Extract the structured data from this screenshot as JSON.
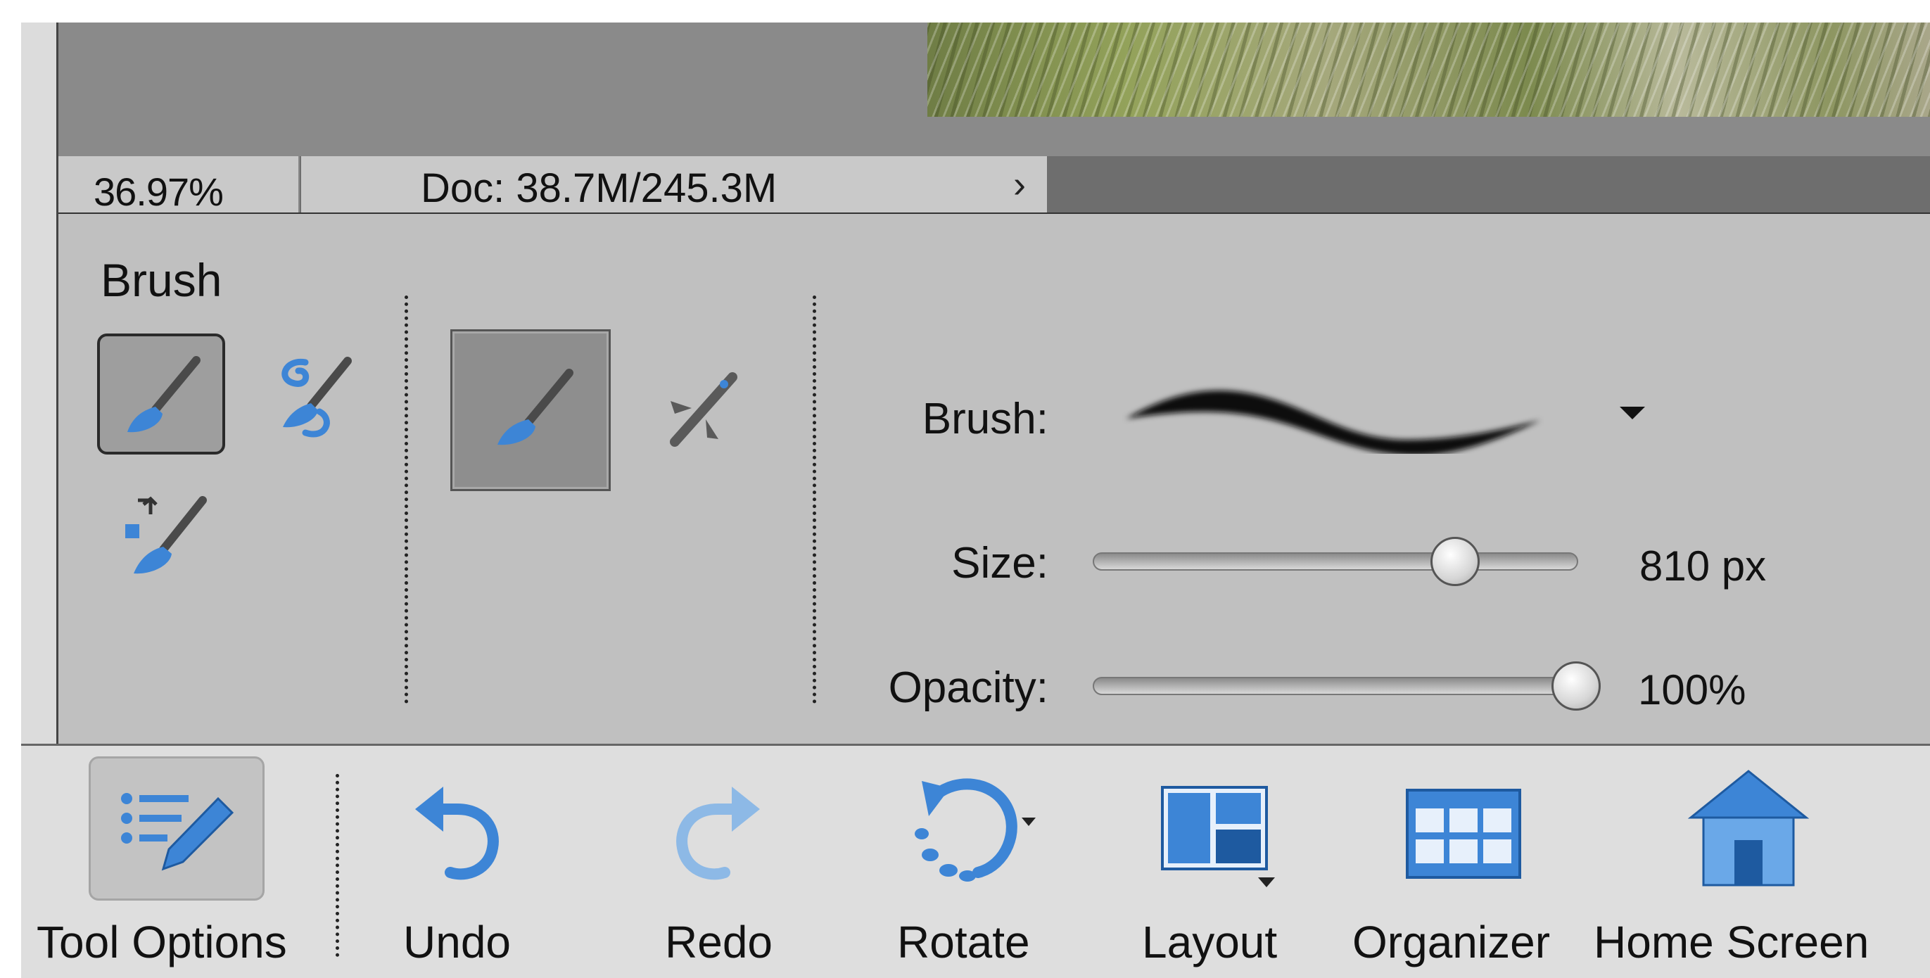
{
  "status_bar": {
    "zoom": "36.97%",
    "doc_info": "Doc: 38.7M/245.3M",
    "more_arrow": "›"
  },
  "tool_options": {
    "section_title": "Brush",
    "brush_label": "Brush:",
    "size_label": "Size:",
    "size_value": "810 px",
    "size_fraction": 0.75,
    "opacity_label": "Opacity:",
    "opacity_value": "100%",
    "opacity_fraction": 1.0,
    "tools": [
      "brush-tool",
      "impressionist-brush-tool",
      "color-replacement-tool"
    ],
    "modes": [
      "brush-mode",
      "airbrush-mode"
    ]
  },
  "taskbar": {
    "tool_options": "Tool Options",
    "undo": "Undo",
    "redo": "Redo",
    "rotate": "Rotate",
    "layout": "Layout",
    "organizer": "Organizer",
    "home_screen": "Home Screen"
  },
  "colors": {
    "icon_blue": "#3d85d6",
    "panel_gray": "#c0c0c0"
  }
}
